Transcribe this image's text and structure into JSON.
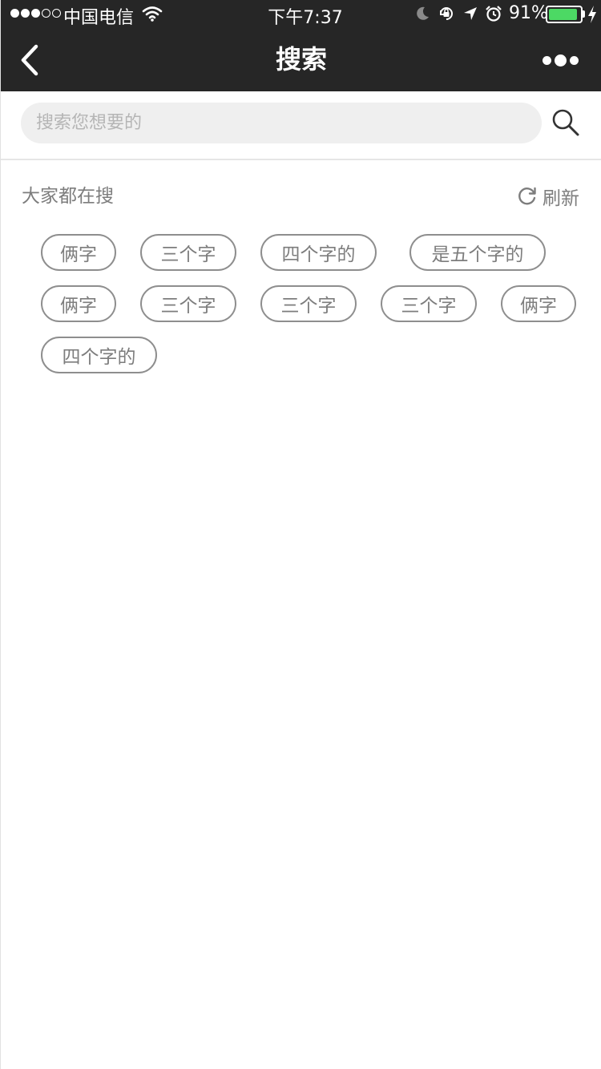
{
  "status_bar": {
    "carrier": "中国电信",
    "time": "下午7:37",
    "battery_percent": "91%",
    "battery_level": 0.91,
    "battery_color": "#4cd964",
    "signal_filled": 3,
    "signal_total": 5
  },
  "nav": {
    "title": "搜索",
    "back_icon": "chevron-left-icon",
    "more_icon": "more-dots-icon"
  },
  "search": {
    "placeholder": "搜索您想要的",
    "value": "",
    "icon": "search-icon"
  },
  "hot": {
    "title": "大家都在搜",
    "refresh_label": "刷新",
    "refresh_icon": "refresh-icon",
    "tags": [
      "俩字",
      "三个字",
      "四个字的",
      "是五个字的",
      "俩字",
      "三个字",
      "三个字",
      "三个字",
      "俩字",
      "四个字的"
    ]
  }
}
